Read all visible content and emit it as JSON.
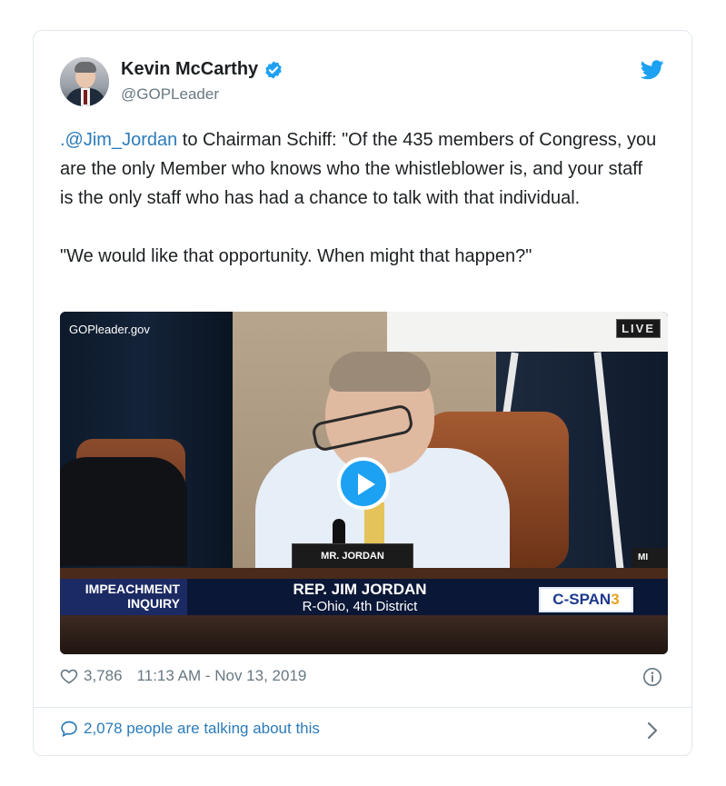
{
  "author": {
    "name": "Kevin McCarthy",
    "handle": "@GOPLeader",
    "verified_icon": "verified-badge-icon",
    "avatar_icon": "user-avatar"
  },
  "brand": {
    "icon": "twitter-bird-icon",
    "color": "#1da1f2"
  },
  "tweet": {
    "mention": ".@Jim_Jordan",
    "text_after_mention": " to Chairman Schiff: \"Of the 435 members of Congress, you are the only Member who knows who the whistleblower is, and your staff is the only staff who has had a chance to talk with that individual.",
    "text_paragraph2": "\"We would like that opportunity. When might that happen?\""
  },
  "video": {
    "source_label": "GOPleader.gov",
    "live_label": "LIVE",
    "nameplate": "MR. JORDAN",
    "nameplate_partial": "MI",
    "lower_third_left_line1": "IMPEACHMENT",
    "lower_third_left_line2": "INQUIRY",
    "lower_third_name": "REP. JIM JORDAN",
    "lower_third_district": "R-Ohio, 4th District",
    "network_logo_main": "C-SPAN",
    "network_logo_num": "3",
    "play_icon": "play-icon"
  },
  "meta": {
    "likes": "3,786",
    "timestamp": "11:13 AM - Nov 13, 2019",
    "heart_icon": "heart-icon",
    "info_icon": "info-icon"
  },
  "footer": {
    "talking_text": "2,078 people are talking about this",
    "bubble_icon": "comment-bubble-icon",
    "chevron_icon": "chevron-right-icon"
  },
  "colors": {
    "link": "#2b7bb9",
    "muted": "#697882",
    "text": "#1c2022",
    "border": "#e1e8ed"
  }
}
